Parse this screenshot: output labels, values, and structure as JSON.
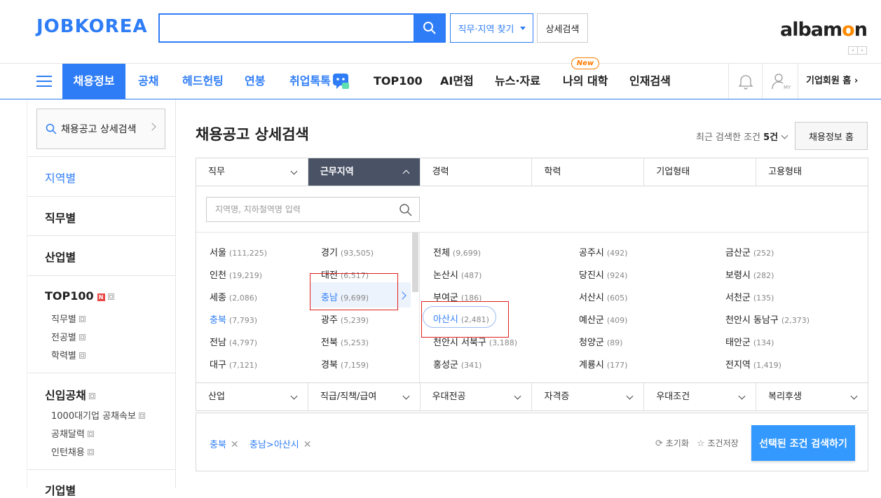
{
  "header": {
    "logo": "JOBKOREA",
    "search_value": "",
    "job_region_button": "직무·지역 찾기",
    "detail_search_button": "상세검색",
    "albamon_logo_prefix": "albam",
    "albamon_logo_o": "o",
    "albamon_logo_suffix": "n",
    "prev_arrow": "‹",
    "next_arrow": "›"
  },
  "nav": {
    "items": [
      "채용정보",
      "공채",
      "헤드헌팅",
      "연봉",
      "취업톡톡",
      "TOP100",
      "AI면접",
      "뉴스·자료",
      "나의 대학",
      "인재검색"
    ],
    "new_badge": "New",
    "my_label": "MY",
    "corp_home": "기업회원 홈 ›"
  },
  "sidebar": {
    "search_label": "채용공고 상세검색",
    "sections": {
      "region": "지역별",
      "job": "직무별",
      "industry": "산업별",
      "top100": "TOP100",
      "top100_badge": "N",
      "top100_sub": [
        "직무별",
        "전공별",
        "학력별"
      ],
      "newgrad": "신입공채",
      "newgrad_sub": [
        "1000대기업 공채속보",
        "공채달력",
        "인턴채용"
      ],
      "company": "기업별"
    }
  },
  "main": {
    "title": "채용공고 상세검색",
    "recent_prefix": "최근 검색한 조건 ",
    "recent_count": "5건",
    "jobinfo_home": "채용정보 홈",
    "tabs_top": [
      "직무",
      "근무지역",
      "경력",
      "학력",
      "기업형태",
      "고용형태"
    ],
    "tabs_bottom": [
      "산업",
      "직급/직책/급여",
      "우대전공",
      "자격증",
      "우대조건",
      "복리후생"
    ],
    "region_placeholder": "지역명, 지하철역명 입력",
    "regions_left": [
      {
        "name": "서울",
        "count": "(111,225)"
      },
      {
        "name": "인천",
        "count": "(19,219)"
      },
      {
        "name": "세종",
        "count": "(2,086)"
      },
      {
        "name": "충북",
        "count": "(7,793)"
      },
      {
        "name": "전남",
        "count": "(4,797)"
      },
      {
        "name": "대구",
        "count": "(7,121)"
      }
    ],
    "regions_mid": [
      {
        "name": "경기",
        "count": "(93,505)"
      },
      {
        "name": "대전",
        "count": "(6,517)"
      },
      {
        "name": "충남",
        "count": "(9,699)"
      },
      {
        "name": "광주",
        "count": "(5,239)"
      },
      {
        "name": "전북",
        "count": "(5,253)"
      },
      {
        "name": "경북",
        "count": "(7,159)"
      }
    ],
    "sub_col1": [
      {
        "name": "전체",
        "count": "(9,699)"
      },
      {
        "name": "논산시",
        "count": "(487)"
      },
      {
        "name": "부여군",
        "count": "(186)"
      },
      {
        "name": "아산시",
        "count": "(2,481)"
      },
      {
        "name": "천안시 서북구",
        "count": "(3,188)"
      },
      {
        "name": "홍성군",
        "count": "(341)"
      }
    ],
    "sub_col2": [
      {
        "name": "공주시",
        "count": "(492)"
      },
      {
        "name": "당진시",
        "count": "(924)"
      },
      {
        "name": "서산시",
        "count": "(605)"
      },
      {
        "name": "예산군",
        "count": "(409)"
      },
      {
        "name": "청양군",
        "count": "(89)"
      },
      {
        "name": "계룡시",
        "count": "(177)"
      }
    ],
    "sub_col3": [
      {
        "name": "금산군",
        "count": "(252)"
      },
      {
        "name": "보령시",
        "count": "(282)"
      },
      {
        "name": "서천군",
        "count": "(135)"
      },
      {
        "name": "천안시 동남구",
        "count": "(2,373)"
      },
      {
        "name": "태안군",
        "count": "(134)"
      },
      {
        "name": "전지역",
        "count": "(1,419)"
      }
    ],
    "selected_chips": [
      "충북",
      "충남>아산시"
    ],
    "reset_label": "초기화",
    "save_label": "조건저장",
    "search_selected": "선택된 조건 검색하기"
  },
  "colors": {
    "brand_blue": "#2f7df6",
    "active_tab": "#4a5366",
    "highlight_box": "#e02020",
    "albamon_orange": "#ff8a00"
  }
}
